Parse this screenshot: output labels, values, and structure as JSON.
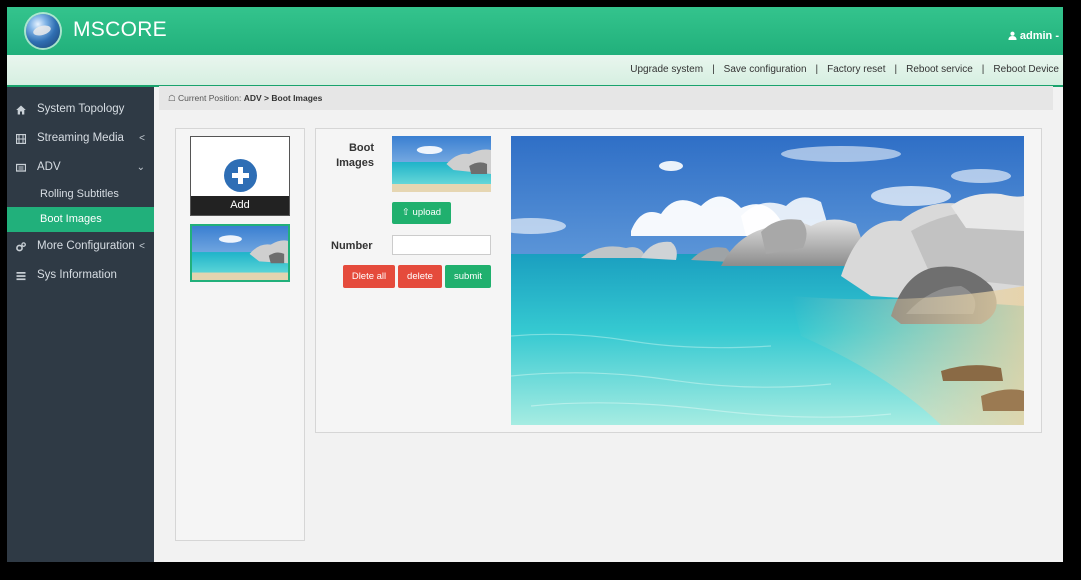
{
  "header": {
    "app_title": "MSCORE",
    "user": "admin"
  },
  "toolbar": {
    "links": [
      "Upgrade system",
      "Save configuration",
      "Factory reset",
      "Reboot service",
      "Reboot Device"
    ]
  },
  "sidebar": {
    "items": [
      {
        "label": "System Topology",
        "icon": "home-icon"
      },
      {
        "label": "Streaming Media",
        "icon": "film-icon",
        "chevron": "<"
      },
      {
        "label": "ADV",
        "icon": "monitor-icon",
        "chevron": "⌄",
        "expanded": true
      },
      {
        "label": "More Configuration",
        "icon": "cogs-icon",
        "chevron": "<"
      },
      {
        "label": "Sys Information",
        "icon": "list-icon"
      }
    ],
    "adv_subitems": [
      {
        "label": "Rolling Subtitles",
        "active": false
      },
      {
        "label": "Boot Images",
        "active": true
      }
    ]
  },
  "breadcrumb": {
    "prefix": "Current Position:",
    "section": "ADV",
    "separator": ">",
    "page": "Boot Images"
  },
  "left_panel": {
    "add_label": "Add"
  },
  "form": {
    "boot_images_label": "Boot Images",
    "upload_label": "upload",
    "number_label": "Number",
    "number_value": "",
    "delete_all_label": "Dlete all",
    "delete_label": "delete",
    "submit_label": "submit"
  },
  "colors": {
    "accent": "#21b07b",
    "sidebar_bg": "#2f3a45",
    "danger": "#e54b3c",
    "add_icon": "#2e6eb5"
  }
}
